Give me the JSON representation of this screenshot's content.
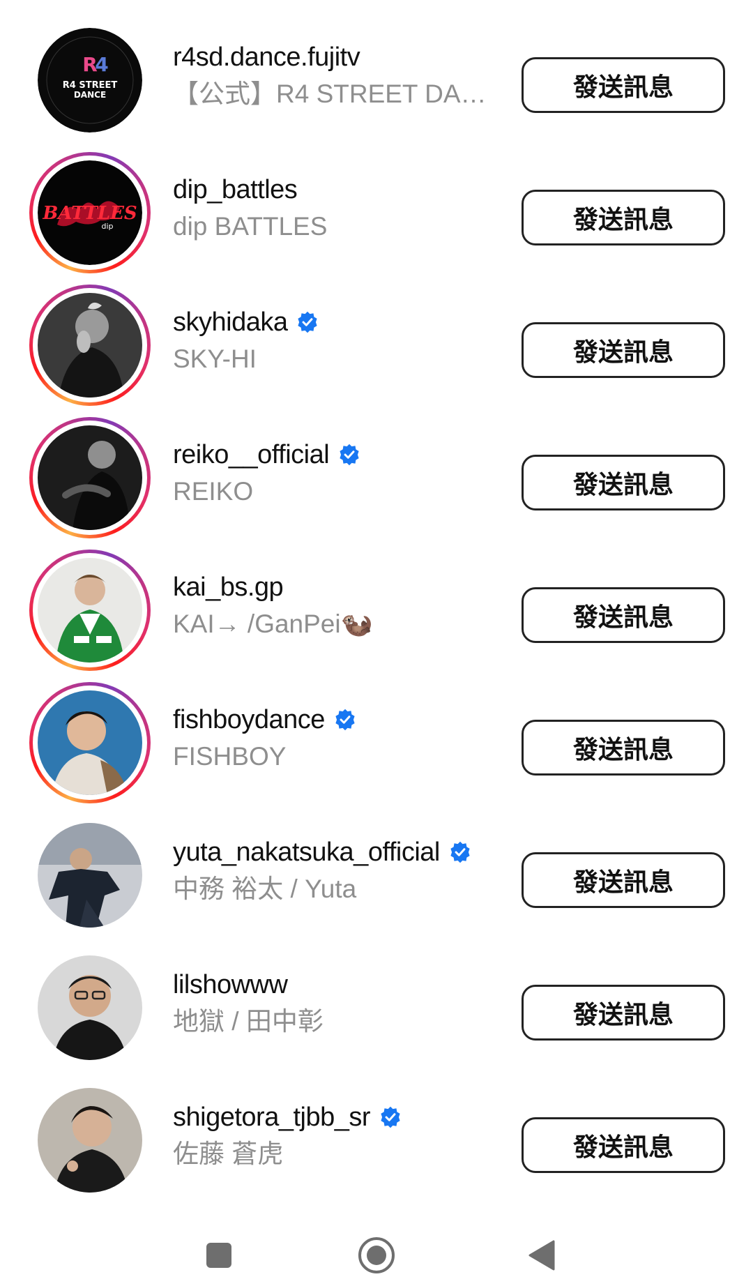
{
  "button_label": "發送訊息",
  "colors": {
    "verified_blue": "#1877f2",
    "secondary_text": "#8e8e8e",
    "story_ring": [
      "#fcb045",
      "#fd1d1d",
      "#c13584",
      "#833ab4"
    ]
  },
  "rows": [
    {
      "username": "r4sd.dance.fujitv",
      "fullname": "【公式】R4 STREET DAN...",
      "verified": false,
      "story_ring": false,
      "avatar": "r4-street-dance-logo"
    },
    {
      "username": "dip_battles",
      "fullname": "dip BATTLES",
      "verified": false,
      "story_ring": true,
      "avatar": "battles-dip-logo"
    },
    {
      "username": "skyhidaka",
      "fullname": "SKY-HI",
      "verified": true,
      "story_ring": true,
      "avatar": "person-photo"
    },
    {
      "username": "reiko__official",
      "fullname": "REIKO",
      "verified": true,
      "story_ring": true,
      "avatar": "person-photo"
    },
    {
      "username": "kai_bs.gp",
      "fullname": "KAI→ /GanPei🦦",
      "verified": false,
      "story_ring": true,
      "avatar": "person-photo"
    },
    {
      "username": "fishboydance",
      "fullname": "FISHBOY",
      "verified": true,
      "story_ring": true,
      "avatar": "person-photo"
    },
    {
      "username": "yuta_nakatsuka_official",
      "fullname": "中務 裕太 / Yuta",
      "verified": true,
      "story_ring": false,
      "avatar": "person-photo"
    },
    {
      "username": "lilshowww",
      "fullname": "地獄 / 田中彰",
      "verified": false,
      "story_ring": false,
      "avatar": "person-photo"
    },
    {
      "username": "shigetora_tjbb_sr",
      "fullname": "佐藤 蒼虎",
      "verified": true,
      "story_ring": false,
      "avatar": "person-photo"
    }
  ],
  "navbar": {
    "items": [
      "recent-apps-icon",
      "home-icon",
      "back-icon"
    ]
  }
}
